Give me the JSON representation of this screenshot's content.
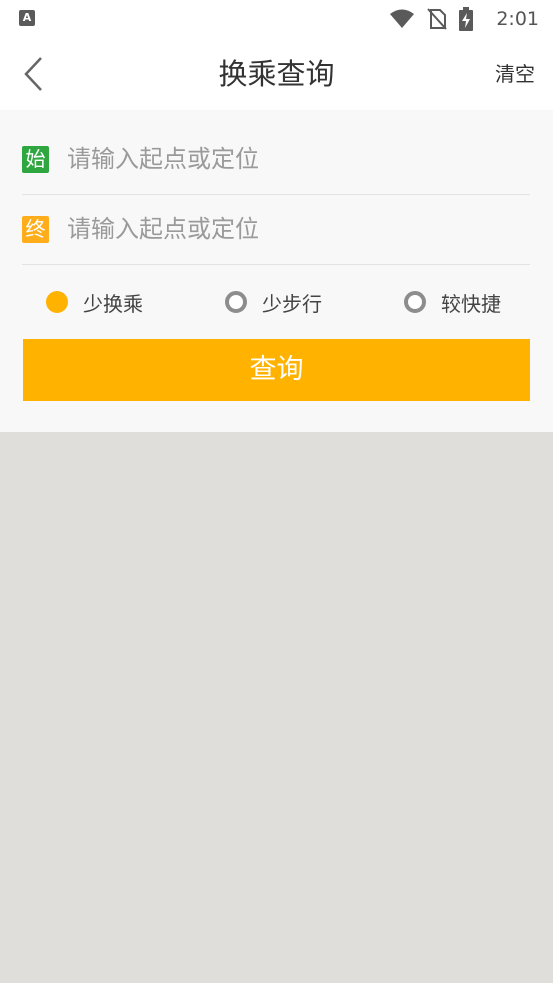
{
  "status_bar": {
    "app_icon": "A",
    "time": "2:01",
    "icons": [
      "wifi-icon",
      "no-sim-icon",
      "battery-charging-icon"
    ]
  },
  "header": {
    "title": "换乘查询",
    "clear_label": "清空",
    "back_icon": "chevron-left-icon"
  },
  "form": {
    "start": {
      "tag": "始",
      "tag_color": "#2fa63f",
      "value": "",
      "placeholder": "请输入起点或定位"
    },
    "end": {
      "tag": "终",
      "tag_color": "#ffad1a",
      "value": "",
      "placeholder": "请输入起点或定位"
    },
    "options": [
      {
        "label": "少换乘",
        "selected": true
      },
      {
        "label": "少步行",
        "selected": false
      },
      {
        "label": "较快捷",
        "selected": false
      }
    ],
    "query_label": "查询"
  },
  "colors": {
    "accent": "#ffb300",
    "map_background": "#dfdeda"
  }
}
